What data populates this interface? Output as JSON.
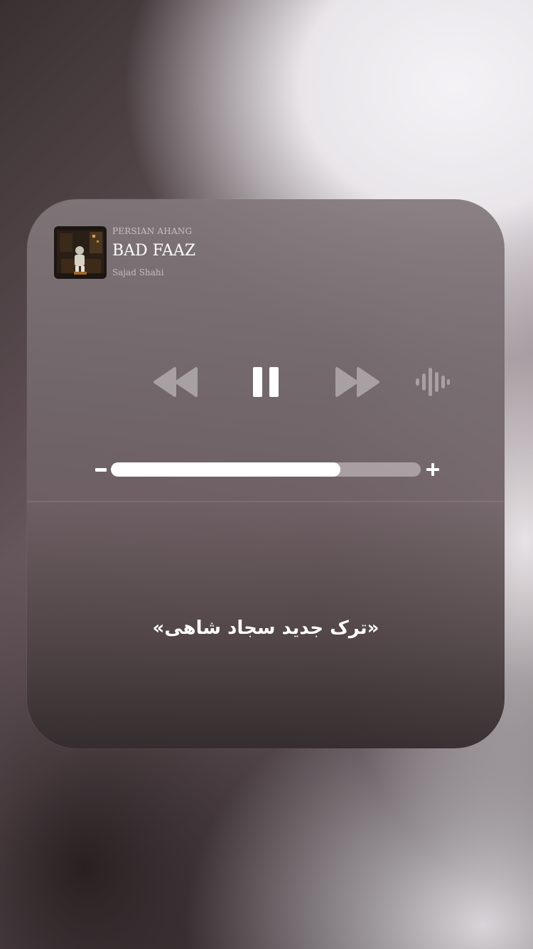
{
  "now_playing": {
    "source_label": "PERSIAN AHANG",
    "track_title": "BAD FAAZ",
    "artist": "Sajad Shahi"
  },
  "controls": {
    "rewind_icon": "backward-icon",
    "play_pause_icon": "pause-icon",
    "forward_icon": "forward-icon",
    "output_icon": "waveform-icon"
  },
  "volume": {
    "level": 0.74
  },
  "caption": "«ترک جدید سجاد شاهی»",
  "colors": {
    "primary_text": "#ffffff",
    "muted_control": "#a8a0a3",
    "track_bg": "#d7cdd0"
  }
}
